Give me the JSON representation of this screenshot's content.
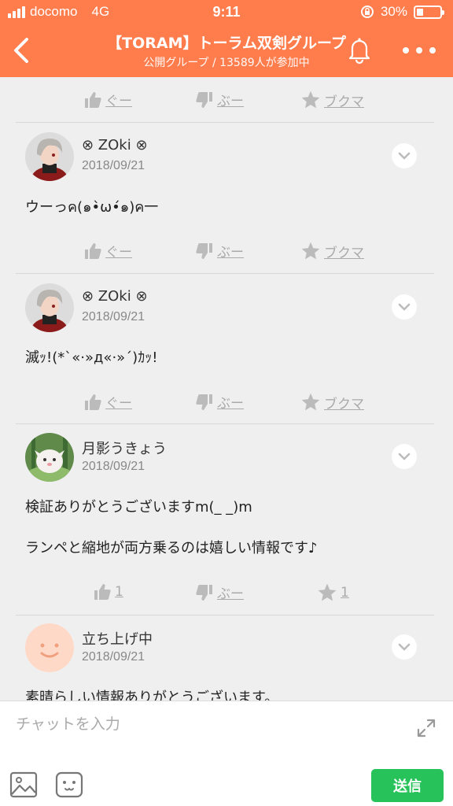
{
  "status_bar": {
    "carrier": "docomo",
    "network": "4G",
    "time": "9:11",
    "battery_text": "30%",
    "battery_level": 0.3
  },
  "header": {
    "title": "【TORAM】トーラム双剣グループ",
    "subtitle": "公開グループ / 13589人が参加中"
  },
  "action_labels": {
    "like": "ぐー",
    "dislike": "ぶー",
    "bookmark": "ブクマ"
  },
  "posts": [
    {
      "user": "⊗ ZOki ⊗",
      "date": "2018/09/21",
      "lines": [
        "ウーっค(๑•̀ω•́๑)ค一"
      ],
      "like": "ぐー",
      "dislike": "ぶー",
      "bookmark": "ブクマ"
    },
    {
      "user": "⊗ ZOki ⊗",
      "date": "2018/09/21",
      "lines": [
        "滅ｯ!(*`«·»д«·»´)ｶｯ!"
      ],
      "like": "ぐー",
      "dislike": "ぶー",
      "bookmark": "ブクマ"
    },
    {
      "user": "月影うきょう",
      "date": "2018/09/21",
      "lines": [
        "検証ありがとうございますm(_ _)m",
        "ランペと縮地が両方乗るのは嬉しい情報です♪"
      ],
      "like": "1",
      "dislike": "ぶー",
      "bookmark": "1"
    },
    {
      "user": "立ち上げ中",
      "date": "2018/09/21",
      "lines": [
        "素晴らしい情報ありがとうございます。"
      ]
    }
  ],
  "input": {
    "placeholder": "チャットを入力",
    "send_label": "送信"
  },
  "colors": {
    "header": "#ff7d4d",
    "send": "#27c35a",
    "background": "#efefef"
  }
}
